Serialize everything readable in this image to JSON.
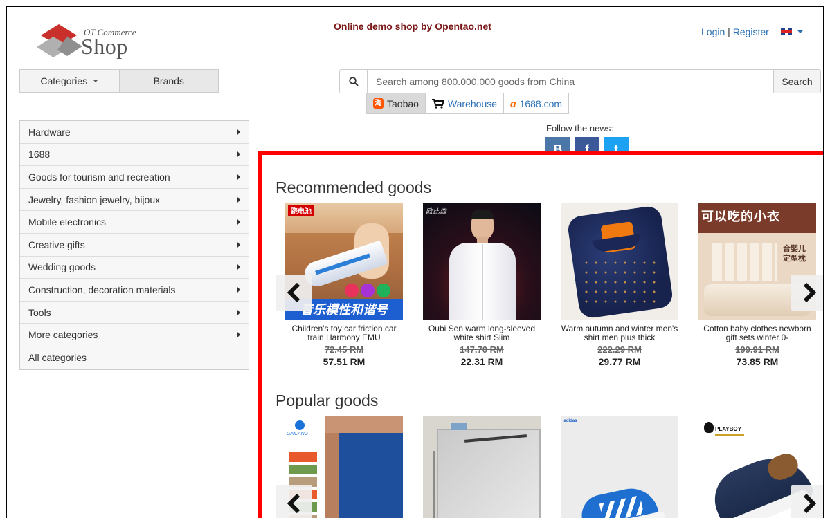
{
  "header": {
    "logo_small": "OT Commerce",
    "logo_big": "Shop",
    "tagline": "Online demo shop by Opentao.net",
    "login": "Login",
    "separator": "|",
    "register": "Register"
  },
  "nav": {
    "categories_label": "Categories",
    "brands_label": "Brands"
  },
  "search": {
    "placeholder": "Search among 800.000.000 goods from China",
    "button_label": "Search"
  },
  "sources": [
    {
      "label": "Taobao",
      "badge": "淘",
      "active": true
    },
    {
      "label": "Warehouse",
      "active": false
    },
    {
      "label": "1688.com",
      "badge": "ɑ",
      "active": false
    }
  ],
  "sidebar": {
    "items": [
      {
        "label": "Hardware"
      },
      {
        "label": "1688"
      },
      {
        "label": "Goods for tourism and recreation"
      },
      {
        "label": "Jewelry, fashion jewelry, bijoux"
      },
      {
        "label": "Mobile electronics"
      },
      {
        "label": "Creative gifts"
      },
      {
        "label": "Wedding goods"
      },
      {
        "label": "Construction, decoration materials"
      },
      {
        "label": "Tools"
      },
      {
        "label": "More categories"
      },
      {
        "label": "All categories"
      }
    ]
  },
  "follow": {
    "label": "Follow the news:",
    "networks": [
      {
        "name": "vk",
        "glyph": "B",
        "color": "#4a76a8"
      },
      {
        "name": "facebook",
        "glyph": "f",
        "color": "#3b5998"
      },
      {
        "name": "twitter",
        "glyph": "t",
        "color": "#1da1f2"
      }
    ]
  },
  "recommended": {
    "title": "Recommended goods",
    "items": [
      {
        "name": "Children's toy car friction car train Harmony EMU",
        "old_price": "72.45 RM",
        "price": "57.51 RM"
      },
      {
        "name": "Oubi Sen warm long-sleeved white shirt Slim",
        "old_price": "147.70 RM",
        "price": "22.31 RM"
      },
      {
        "name": "Warm autumn and winter men's shirt men plus thick",
        "old_price": "222.29 RM",
        "price": "29.77 RM"
      },
      {
        "name": "Cotton baby clothes newborn gift sets winter 0-",
        "old_price": "199.91 RM",
        "price": "73.85 RM"
      }
    ]
  },
  "popular": {
    "title": "Popular goods",
    "items": [
      {
        "brand": "GAILANG"
      },
      {
        "brand": ""
      },
      {
        "brand": "adidas"
      },
      {
        "brand": "PLAYBOY"
      }
    ]
  },
  "product_image_text": {
    "toy_badge": "跷电池",
    "toy_caption": "音乐模性和谐号",
    "shirt_badge": "欧比森",
    "baby_title": "可以吃的小衣",
    "baby_sub1": "合婴儿",
    "baby_sub2": "定型枕"
  }
}
